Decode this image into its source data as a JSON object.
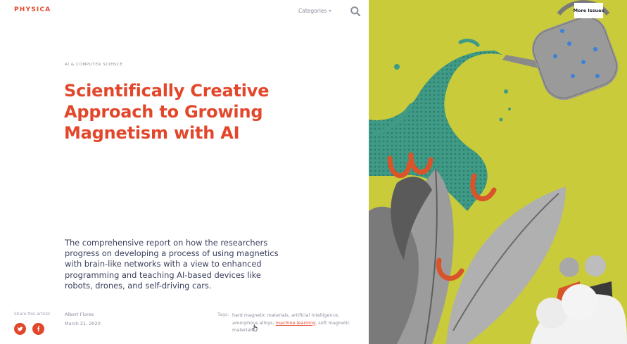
{
  "header": {
    "logo": "PHYSICA",
    "categories_label": "Categories",
    "more_issues_label": "More Issues"
  },
  "article": {
    "kicker": "AI & COMPUTER SCIENCE",
    "title_lines": [
      "Scientifically Creative",
      "Approach to Growing",
      "Magnetism with AI"
    ],
    "summary": "The comprehensive report on how the researchers progress on developing a process of using magnetics with brain-like networks with a view to enhanced programming and teaching AI-based devices like robots, drones, and self-driving cars.",
    "author": "Albert Flores",
    "date": "March 21, 2020"
  },
  "share": {
    "label": "Share this articel",
    "networks": [
      "twitter-icon",
      "facebook-icon"
    ]
  },
  "tags": {
    "label": "Tags:",
    "items": [
      {
        "text": "hard magnetic materials",
        "sep": ", "
      },
      {
        "text": "artificial intelligence",
        "sep": ", "
      },
      {
        "text": "amorphous alloys",
        "sep": ", "
      },
      {
        "text": "machine learning",
        "sep": ", ",
        "active": true
      },
      {
        "text": "soft magnetic materials",
        "sep": ""
      }
    ]
  },
  "colors": {
    "accent": "#e2472b",
    "text": "#3a3f5c",
    "muted": "#8a8d9c",
    "illustration_bg": "#c9cb3a",
    "teal": "#3f9a86"
  }
}
